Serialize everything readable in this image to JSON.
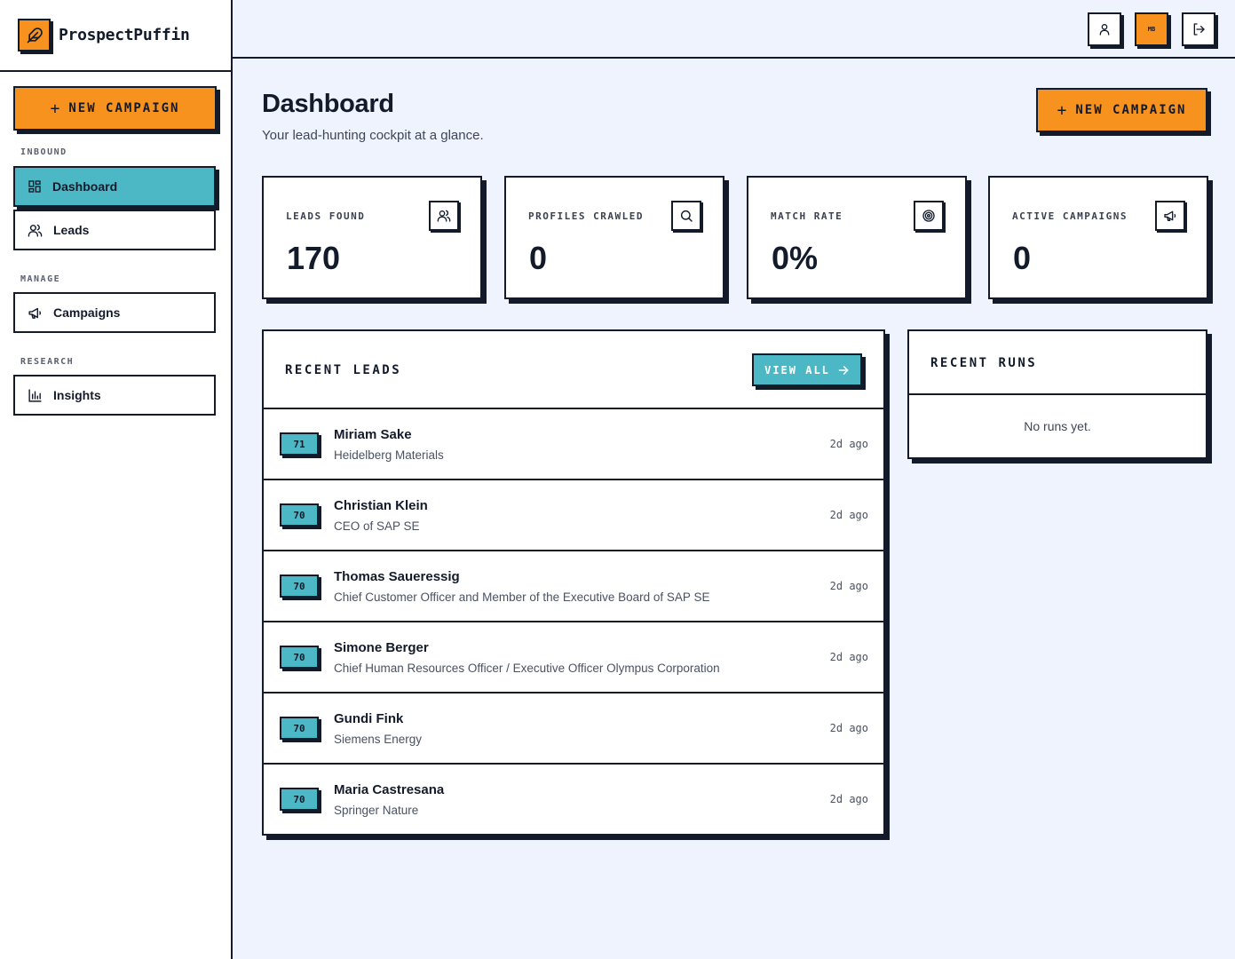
{
  "brand": {
    "name": "ProspectPuffin"
  },
  "sidebar": {
    "new_campaign": "NEW CAMPAIGN",
    "sections": [
      {
        "label": "INBOUND"
      },
      {
        "label": "MANAGE"
      },
      {
        "label": "RESEARCH"
      }
    ],
    "items": [
      {
        "label": "Dashboard",
        "icon": "dashboard-icon",
        "active": true
      },
      {
        "label": "Leads",
        "icon": "users-icon",
        "active": false
      },
      {
        "label": "Campaigns",
        "icon": "megaphone-icon",
        "active": false
      },
      {
        "label": "Insights",
        "icon": "bar-chart-icon",
        "active": false
      }
    ]
  },
  "topbar": {
    "avatar_initials": "MB"
  },
  "main": {
    "title": "Dashboard",
    "subtitle": "Your lead-hunting cockpit at a glance.",
    "new_campaign": "NEW CAMPAIGN"
  },
  "stats": [
    {
      "label": "LEADS FOUND",
      "value": "170",
      "icon": "users-icon"
    },
    {
      "label": "PROFILES CRAWLED",
      "value": "0",
      "icon": "search-icon"
    },
    {
      "label": "MATCH RATE",
      "value": "0%",
      "icon": "target-icon"
    },
    {
      "label": "ACTIVE CAMPAIGNS",
      "value": "0",
      "icon": "megaphone-icon"
    }
  ],
  "recent_leads": {
    "title": "RECENT LEADS",
    "view_all": "VIEW ALL",
    "leads": [
      {
        "score": "71",
        "name": "Miriam Sake",
        "subtitle": "Heidelberg Materials",
        "time": "2d ago"
      },
      {
        "score": "70",
        "name": "Christian Klein",
        "subtitle": "CEO of SAP SE",
        "time": "2d ago"
      },
      {
        "score": "70",
        "name": "Thomas Saueressig",
        "subtitle": "Chief Customer Officer and Member of the Executive Board of SAP SE",
        "time": "2d ago"
      },
      {
        "score": "70",
        "name": "Simone Berger",
        "subtitle": "Chief Human Resources Officer / Executive Officer Olympus Corporation",
        "time": "2d ago"
      },
      {
        "score": "70",
        "name": "Gundi Fink",
        "subtitle": "Siemens Energy",
        "time": "2d ago"
      },
      {
        "score": "70",
        "name": "Maria Castresana",
        "subtitle": "Springer Nature",
        "time": "2d ago"
      }
    ]
  },
  "recent_runs": {
    "title": "RECENT RUNS",
    "empty": "No runs yet."
  },
  "colors": {
    "accent_orange": "#f7921e",
    "accent_teal": "#4cb8c5",
    "ink": "#131b2b",
    "background": "#eef3fd"
  }
}
